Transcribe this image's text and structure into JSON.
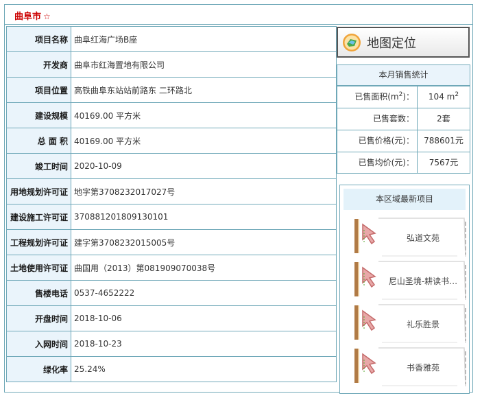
{
  "header": {
    "city": "曲阜市",
    "star": "☆"
  },
  "details": [
    {
      "label": "项目名称",
      "value": "曲阜红海广场B座"
    },
    {
      "label": "开发商",
      "value": "曲阜市红海置地有限公司"
    },
    {
      "label": "项目位置",
      "value": "高铁曲阜东站站前路东 二环路北"
    },
    {
      "label": "建设规模",
      "value": "40169.00 平方米"
    },
    {
      "label": "总 面 积",
      "value": "40169.00 平方米"
    },
    {
      "label": "竣工时间",
      "value": "2020-10-09"
    },
    {
      "label": "用地规划许可证",
      "value": "地字第3708232017027号"
    },
    {
      "label": "建设施工许可证",
      "value": "370881201809130101"
    },
    {
      "label": "工程规划许可证",
      "value": "建字第3708232015005号"
    },
    {
      "label": "土地使用许可证",
      "value": "曲国用（2013）第081909070038号"
    },
    {
      "label": "售楼电话",
      "value": "0537-4652222"
    },
    {
      "label": "开盘时间",
      "value": "2018-10-06"
    },
    {
      "label": "入网时间",
      "value": "2018-10-23"
    },
    {
      "label": "绿化率",
      "value": "25.24%"
    }
  ],
  "map_button": {
    "label": "地图定位",
    "icon": "map-globe-icon"
  },
  "sales": {
    "title": "本月销售统计",
    "sold_area_label": "已售面积(m",
    "sold_area_sup": "2",
    "sold_area_label_end": ")：",
    "sold_area_value": "104 m",
    "sold_area_value_sup": "2",
    "sold_units_label": "已售套数：",
    "sold_units_value": "2套",
    "price_label": "已售价格(元)：",
    "price_value": "788601元",
    "avg_label": "已售均价(元)：",
    "avg_value": "7567元"
  },
  "recent": {
    "title": "本区域最新项目",
    "items": [
      "弘道文苑",
      "尼山圣境-耕读书…",
      "礼乐胜景",
      "书香雅苑"
    ]
  },
  "colors": {
    "border": "#6fa8b8",
    "label_bg": "#eaf4fb",
    "accent_red": "#cc0000"
  }
}
